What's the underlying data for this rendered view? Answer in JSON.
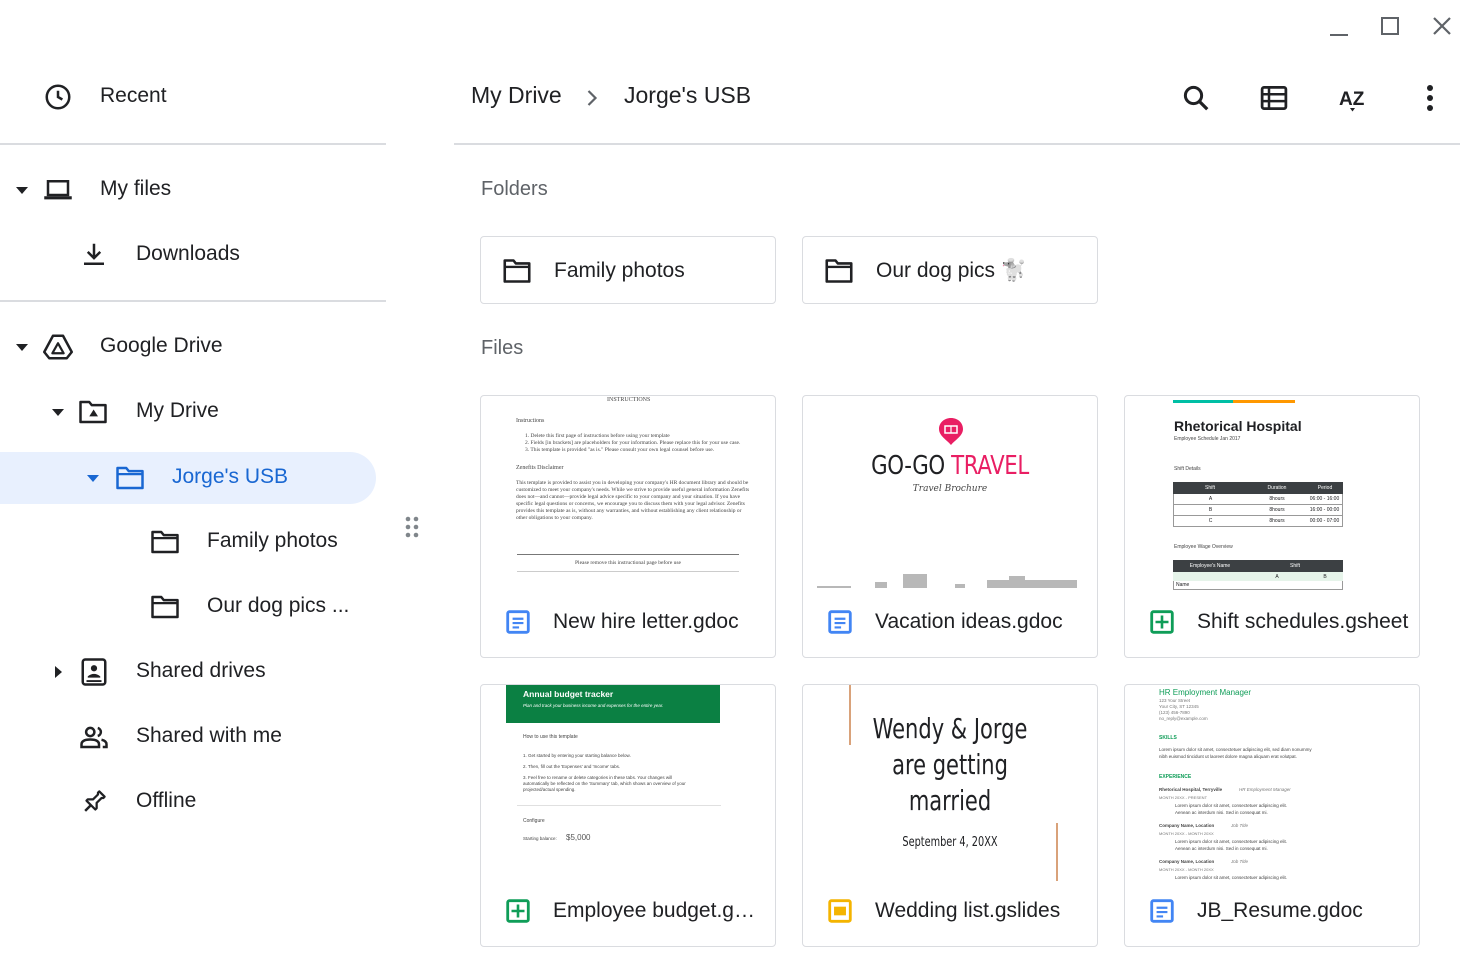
{
  "window": {
    "controls": [
      "minimize-icon",
      "maximize-icon",
      "close-icon"
    ]
  },
  "sidebar": {
    "recent": "Recent",
    "my_files": "My files",
    "downloads": "Downloads",
    "google_drive": "Google Drive",
    "my_drive": "My Drive",
    "jorges_usb": "Jorge's USB",
    "family_photos": "Family photos",
    "our_dog_pics": "Our dog pics ...",
    "shared_drives": "Shared drives",
    "shared_with_me": "Shared with me",
    "offline": "Offline"
  },
  "breadcrumb": {
    "items": [
      "My Drive",
      "Jorge's USB"
    ]
  },
  "toolbar": {
    "icons": [
      "search-icon",
      "list-view-icon",
      "sort-az-icon",
      "more-vert-icon"
    ],
    "sort_label": "AZ"
  },
  "sections": {
    "folders": "Folders",
    "files": "Files"
  },
  "folders": [
    {
      "name": "Family photos"
    },
    {
      "name": "Our dog pics 🐩"
    }
  ],
  "files": [
    {
      "name": "New hire letter.gdoc",
      "type": "doc"
    },
    {
      "name": "Vacation ideas.gdoc",
      "type": "doc"
    },
    {
      "name": "Shift schedules.gsheet",
      "type": "sheet"
    },
    {
      "name": "Employee budget.gsheet",
      "type": "sheet"
    },
    {
      "name": "Wedding list.gslides",
      "type": "slides"
    },
    {
      "name": "JB_Resume.gdoc",
      "type": "doc"
    }
  ],
  "thumbnails": {
    "new_hire": {
      "heading": "INSTRUCTIONS",
      "section1": "Instructions",
      "items": [
        "1.  Delete this first page of instructions before using your template",
        "2.  Fields [in brackets] are placeholders for your information. Please replace this for your use case.",
        "3.  This template is provided \"as is.\" Please consult your own legal counsel before use."
      ],
      "section2": "Zenefits Disclaimer",
      "para": [
        "This template is provided to assist you in developing your company's HR document library and should be",
        "customized to meet your company's needs. While we strive to provide useful general information Zenefits",
        "does not—and cannot—provide legal advice specific to your company and your situation. If you have",
        "specific legal questions or concerns, we encourage you to discuss them with your legal advisor. Zenefits",
        "provides this template as is, without any warranties, and without establishing any client relationship or",
        "other obligations to your company."
      ],
      "footer_note": "Please remove this instructional page before use"
    },
    "vacation": {
      "brand": "GO-GO",
      "brand_accent": "TRAVEL",
      "tagline": "Travel Brochure",
      "brand_color": "#e91e63"
    },
    "shift": {
      "title": "Rhetorical Hospital",
      "subtitle": "Employee Schedule Jan 2017",
      "section1": "Shift Details",
      "table1_headers": [
        "Shift",
        "Duration",
        "Period"
      ],
      "table1_rows": [
        [
          "A",
          "8hours",
          "06:00 - 16:00"
        ],
        [
          "B",
          "8hours",
          "16:00 - 00:00"
        ],
        [
          "C",
          "8hours",
          "00:00 - 07:00"
        ]
      ],
      "section2": "Employee Wage Overview",
      "table2_headers": [
        "Employee's Name",
        "Shift"
      ],
      "table2_sub": [
        "A",
        "B"
      ],
      "table2_row": "Name"
    },
    "budget": {
      "title": "Annual budget tracker",
      "subtitle": "Plan and track your business income and expenses for the entire year.",
      "howto": "How to use this template",
      "steps": [
        "1.  Get started by entering your starting balance below.",
        "2.  Then, fill out the 'Expenses' and 'Income' tabs.",
        "3.  Feel free to rename or delete categories in these tabs. Your changes will",
        "     automatically be reflected on the 'Summary' tab, which shows an overview of your",
        "     projected/actual spending."
      ],
      "configure": "Configure",
      "balance_label": "Starting balance:",
      "balance_value": "$5,000",
      "header_color": "#0b8043"
    },
    "wedding": {
      "line1": "Wendy & Jorge",
      "line2": "are getting",
      "line3": "married",
      "date": "September 4, 20XX"
    },
    "resume": {
      "role": "HR Employment Manager",
      "address": [
        "123 Your Street",
        "Your City, ST 12345",
        "(123) 456-7890",
        "no_reply@example.com"
      ],
      "skills": "SKILLS",
      "skills_text": [
        "Lorem ipsum dolor sit amet, consectetuer adipiscing elit, sed diam nonummy",
        "nibh euismod tincidunt ut laoreet dolore magna aliquam erat volutpat."
      ],
      "experience": "EXPERIENCE",
      "jobs": [
        {
          "company": "Rhetorical Hospital, Terryville",
          "title": "HR Employment Manager",
          "dates": "MONTH 20XX - PRESENT",
          "bullets": [
            "Lorem ipsum dolor sit amet, consectetuer adipiscing elit.",
            "Aenean ac interdum nisi. Sed in consequat mi."
          ]
        },
        {
          "company": "Company Name, Location",
          "title": "Job Title",
          "dates": "MONTH 20XX - MONTH 20XX",
          "bullets": [
            "Lorem ipsum dolor sit amet, consectetuer adipiscing elit.",
            "Aenean ac interdum nisi. Sed in consequat mi."
          ]
        },
        {
          "company": "Company Name, Location",
          "title": "Job Title",
          "dates": "MONTH 20XX - MONTH 20XX",
          "bullets": [
            "Lorem ipsum dolor sit amet, consectetuer adipiscing elit."
          ]
        }
      ],
      "accent_color": "#0f9d58"
    }
  },
  "colors": {
    "accent": "#1967d2",
    "selected_bg": "#e8f0fe",
    "doc_blue": "#4285f4",
    "sheet_green": "#0f9d58",
    "slides_yellow": "#f4b400",
    "divider": "#dadce0"
  }
}
